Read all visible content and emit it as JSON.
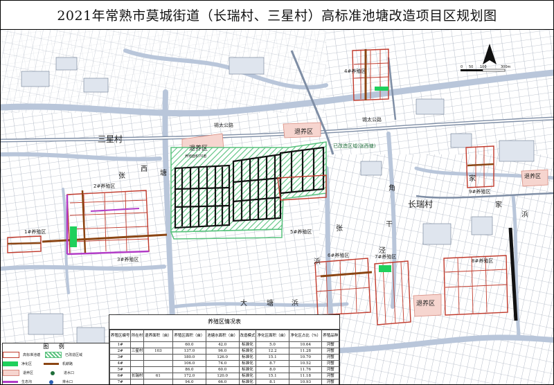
{
  "title": "2021年常熟市莫城街道（长瑞村、三星村）高标准池塘改造项目区规划图",
  "scale": {
    "ticks": [
      "0",
      "50",
      "100",
      "300m"
    ]
  },
  "north_arrow_icon": "north-arrow-icon",
  "colors": {
    "background": "#ffffff",
    "water": "#cfd8e6",
    "road": "#9aa6b8",
    "line": "#5c6a80",
    "boundary": "#c0392b",
    "retreat_fill": "#f6d5cf",
    "ditch": "#8b4513",
    "pond": "#2e8b57",
    "hatch_green": "#58c27d",
    "purple_channel": "#b23cc7",
    "dark_trail": "#111111"
  },
  "map_labels": {
    "sanxing_village": "三星村",
    "changrui_village": "长瑞村",
    "xitang_chars": [
      "西",
      "塘"
    ],
    "zhang_char": "张",
    "jiao_chars": [
      "角",
      "泾"
    ],
    "gan_char": "干",
    "jia_char": "家",
    "bang_char": "浜",
    "zhang_char_2": "张",
    "datang_chars": [
      "大",
      "塘",
      "浜"
    ],
    "road_name": "锡太公路",
    "reformed_area": "已改造区域(张西塘)",
    "area_1": "1#养殖区",
    "area_2": "2#养殖区",
    "area_3": "3#养殖区",
    "area_4": "4#养殖区",
    "area_5": "5#养殖区",
    "area_6": "6#养殖区",
    "area_7": "7#养殖区",
    "area_8": "8#养殖区",
    "area_9": "9#养殖区",
    "retreat": "退养区",
    "retreat_note": "养殖面积70亩"
  },
  "legend": {
    "title": "图 例",
    "items": [
      {
        "label": "高标准池塘",
        "swatch": "box-red"
      },
      {
        "label": "已改造区域",
        "swatch": "hatch"
      },
      {
        "label": "净化区",
        "swatch": "green"
      },
      {
        "label": "机耕路",
        "swatch": "brown"
      },
      {
        "label": "退养区",
        "swatch": "pink"
      },
      {
        "label": "进水口",
        "swatch": "dot"
      },
      {
        "label": "生态沟",
        "swatch": "purple"
      },
      {
        "label": "排水口",
        "swatch": "dot2"
      }
    ]
  },
  "table": {
    "title": "养殖区情况表",
    "headers": [
      "养殖区编号",
      "所在村",
      "退养面积（亩）",
      "养殖区面积（亩）",
      "池塘水面积（亩）",
      "改造模式",
      "净化区面积（亩）",
      "净化区占比（%）",
      "养殖品种"
    ],
    "rows": [
      [
        "1#",
        "",
        "",
        "60.0",
        "42.0",
        "标准化",
        "5.0",
        "10.64",
        "河蟹"
      ],
      [
        "2#",
        "三星村",
        "103",
        "137.0",
        "96.0",
        "标准化",
        "12.2",
        "11.28",
        "河蟹"
      ],
      [
        "3#",
        "",
        "",
        "180.0",
        "126.0",
        "标准化",
        "15.1",
        "10.70",
        "河蟹"
      ],
      [
        "4#",
        "",
        "",
        "106.0",
        "74.0",
        "标准化",
        "8.7",
        "10.52",
        "河蟹"
      ],
      [
        "5#",
        "",
        "",
        "86.0",
        "60.0",
        "标准化",
        "8.0",
        "11.76",
        "河蟹"
      ],
      [
        "6#",
        "长瑞村",
        "61",
        "172.0",
        "120.0",
        "标准化",
        "15.1",
        "11.18",
        "河蟹"
      ],
      [
        "7#",
        "",
        "",
        "94.0",
        "66.0",
        "标准化",
        "8.1",
        "10.93",
        "河蟹"
      ]
    ]
  }
}
